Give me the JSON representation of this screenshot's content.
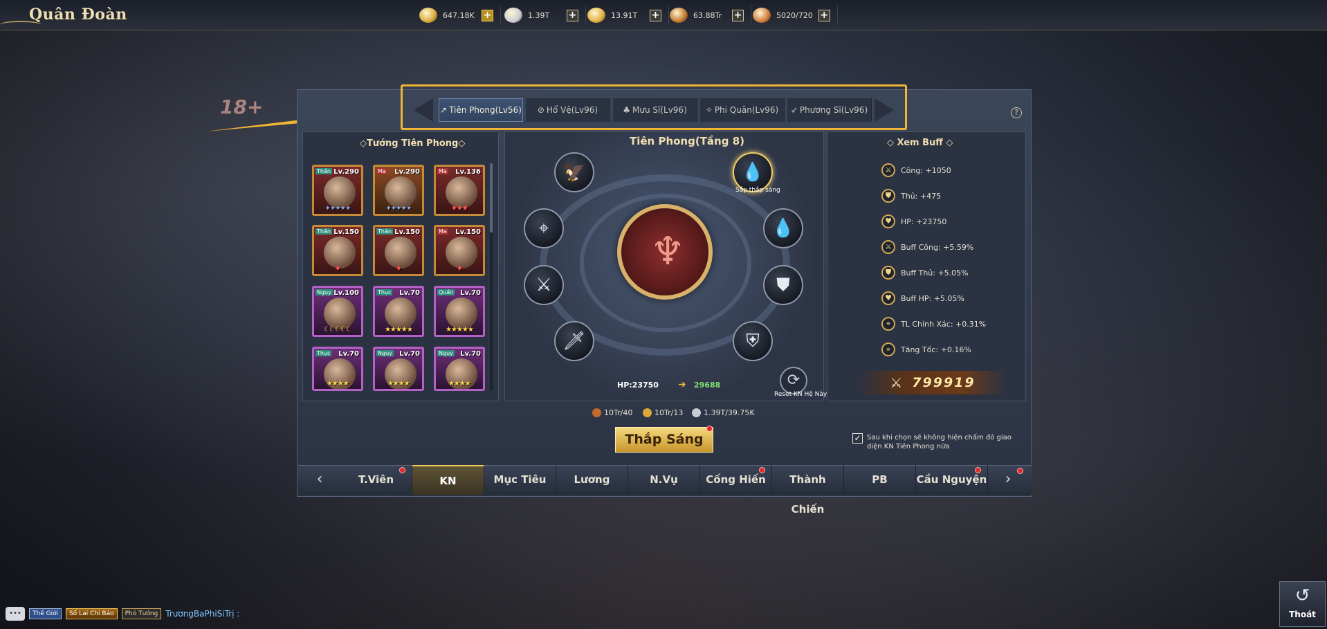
{
  "app": {
    "title": "Quân Đoàn"
  },
  "currencies": [
    {
      "icon": "gold-ingot-icon",
      "value": "647.18K",
      "plus": "+"
    },
    {
      "icon": "silver-coin-icon",
      "value": "1.39T",
      "plus": "+"
    },
    {
      "icon": "feather-icon",
      "value": "13.91T",
      "plus": "+"
    },
    {
      "icon": "scroll-icon",
      "value": "63.88Tr",
      "plus": "+"
    },
    {
      "icon": "fist-icon",
      "value": "5020/720",
      "plus": "+"
    }
  ],
  "age_badge": "18+",
  "help_label": "?",
  "tabs": [
    {
      "icon": "↗",
      "label": "Tiên Phong(Lv56)",
      "active": true
    },
    {
      "icon": "⊘",
      "label": "Hổ Vệ(Lv96)"
    },
    {
      "icon": "♣",
      "label": "Mưu Sĩ(Lv96)"
    },
    {
      "icon": "✧",
      "label": "Phi Quân(Lv96)"
    },
    {
      "icon": "➶",
      "label": "Phương Sĩ(Lv96)"
    }
  ],
  "heroes": {
    "title": "Tướng Tiên Phong",
    "list": [
      {
        "badge": "Thần",
        "level": "Lv.290",
        "stars": "✦✦✦✦✦",
        "stars_color": "blue",
        "frame": "red"
      },
      {
        "badge": "Ma",
        "level": "Lv.290",
        "stars": "✦✦✦✦✦",
        "stars_color": "blue",
        "frame": "gold"
      },
      {
        "badge": "Ma",
        "level": "Lv.136",
        "stars": "♦♦♦",
        "stars_color": "red",
        "frame": "red"
      },
      {
        "badge": "Thần",
        "level": "Lv.150",
        "stars": "♦",
        "stars_color": "red",
        "frame": "red"
      },
      {
        "badge": "Thần",
        "level": "Lv.150",
        "stars": "♦",
        "stars_color": "red",
        "frame": "red"
      },
      {
        "badge": "Ma",
        "level": "Lv.150",
        "stars": "♦",
        "stars_color": "red",
        "frame": "red"
      },
      {
        "badge": "Ngụy",
        "level": "Lv.100",
        "stars": "☾☾☾☾☾",
        "stars_color": "gold",
        "frame": "purple"
      },
      {
        "badge": "Thục",
        "level": "Lv.70",
        "stars": "★★★★★",
        "stars_color": "gold",
        "frame": "purple"
      },
      {
        "badge": "Quần",
        "level": "Lv.70",
        "stars": "★★★★★",
        "stars_color": "gold",
        "frame": "purple"
      },
      {
        "badge": "Thục",
        "level": "Lv.70",
        "stars": "★★★★",
        "stars_color": "gold",
        "frame": "purple"
      },
      {
        "badge": "Ngụy",
        "level": "Lv.70",
        "stars": "★★★★",
        "stars_color": "gold",
        "frame": "purple"
      },
      {
        "badge": "Ngụy",
        "level": "Lv.70",
        "stars": "★★★★",
        "stars_color": "gold",
        "frame": "purple"
      }
    ]
  },
  "wheel": {
    "title": "Tiên Phong(Tầng 8)",
    "core_symbol": "♆",
    "nodes": [
      {
        "name": "eagle-node",
        "glyph": "🦅"
      },
      {
        "name": "water-drop-node",
        "glyph": "💧",
        "active": true,
        "label": "Sắp thắp sáng"
      },
      {
        "name": "target-node",
        "glyph": "⌖"
      },
      {
        "name": "water-plus-node",
        "glyph": "💧"
      },
      {
        "name": "sword-plus-node",
        "glyph": "⚔"
      },
      {
        "name": "shield-node",
        "glyph": "⛊"
      },
      {
        "name": "sword-node",
        "glyph": "🗡"
      },
      {
        "name": "shield-plus-node",
        "glyph": "⛨"
      }
    ],
    "hp_from": "HP:23750",
    "hp_to": "29688",
    "reset_label": "Reset KN Hệ Này"
  },
  "buffs": {
    "title": "Xem Buff",
    "list": [
      {
        "icon": "⚔",
        "text": "Công: +1050"
      },
      {
        "icon": "⛊",
        "text": "Thủ: +475"
      },
      {
        "icon": "♥",
        "text": "HP: +23750"
      },
      {
        "icon": "⚔",
        "text": "Buff Công: +5.59%"
      },
      {
        "icon": "⛊",
        "text": "Buff Thủ: +5.05%"
      },
      {
        "icon": "♥",
        "text": "Buff HP: +5.05%"
      },
      {
        "icon": "⌖",
        "text": "TL Chính Xác: +0.31%"
      },
      {
        "icon": "»",
        "text": "Tăng Tốc: +0.16%"
      }
    ],
    "power": "799919"
  },
  "costs": [
    {
      "color": "#c56a2a",
      "text": "10Tr/40"
    },
    {
      "color": "#d9a93a",
      "text": "10Tr/13"
    },
    {
      "color": "#c8ccd4",
      "text": "1.39T/39.75K"
    }
  ],
  "light_button": "Thắp Sáng",
  "checkbox": {
    "checked": "✓",
    "label": "Sau khi chọn sẽ không hiện chấm đỏ giao diện KN Tiên Phong nữa"
  },
  "bottom_tabs": [
    {
      "label": "T.Viên",
      "dot": true
    },
    {
      "label": "KN",
      "active": true
    },
    {
      "label": "Mục Tiêu"
    },
    {
      "label": "Lương"
    },
    {
      "label": "N.Vụ"
    },
    {
      "label": "Cống Hiến",
      "dot": true
    },
    {
      "label": "Thành Chiến"
    },
    {
      "label": "PB"
    },
    {
      "label": "Cầu Nguyện",
      "dot": true
    }
  ],
  "chat": {
    "channel": "Thế Giới",
    "badge": "Số Lai Chi Bảo",
    "role": "Phó Tướng",
    "name": "TrươngBaPhiSiTrị :"
  },
  "exit_label": "Thoát",
  "colors": {
    "accent_gold": "#f0b535",
    "panel_bg": "#2b3242"
  }
}
